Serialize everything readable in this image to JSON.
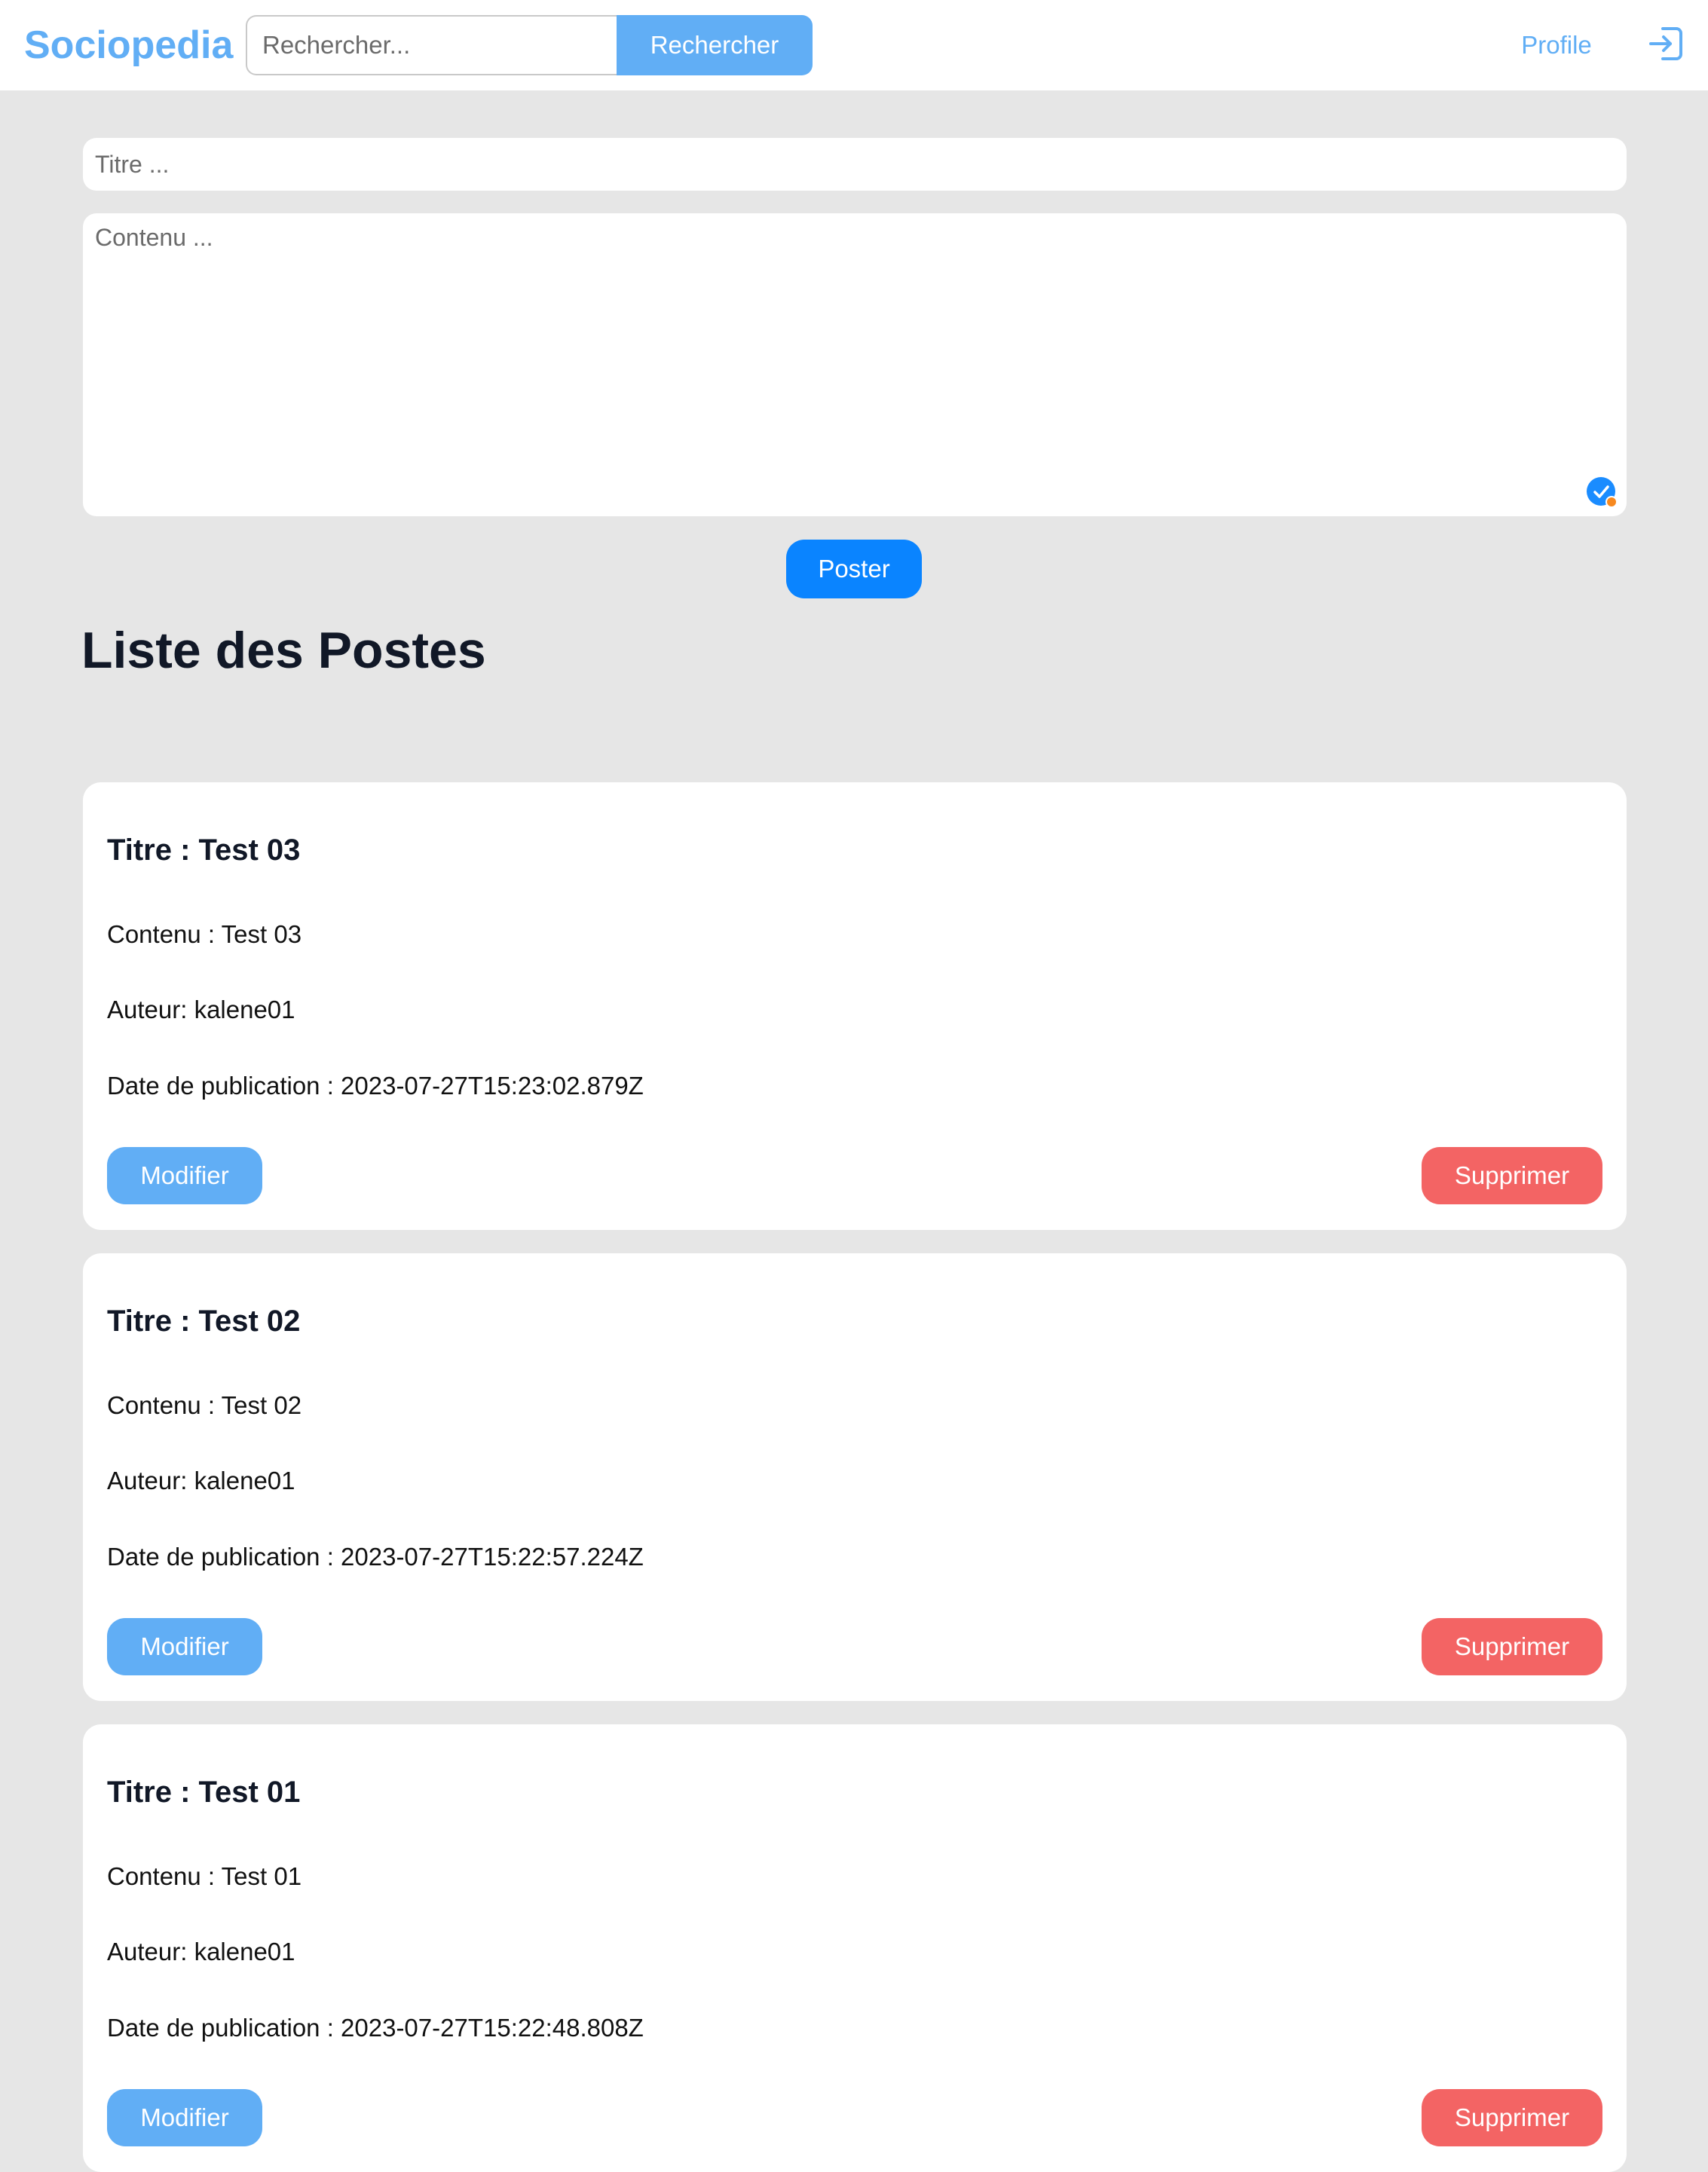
{
  "header": {
    "brand": "Sociopedia",
    "search_placeholder": "Rechercher...",
    "search_button": "Rechercher",
    "profile_link": "Profile",
    "logout_icon": "logout-icon"
  },
  "composer": {
    "title_placeholder": "Titre ...",
    "content_placeholder": "Contenu ...",
    "post_button": "Poster",
    "badge_icon": "grammar-check-icon"
  },
  "section_title": "Liste des Postes",
  "posts": [
    {
      "title": "Titre : Test 03",
      "content": "Contenu : Test 03",
      "author": "Auteur: kalene01",
      "date": "Date de publication : 2023-07-27T15:23:02.879Z",
      "edit_label": "Modifier",
      "delete_label": "Supprimer"
    },
    {
      "title": "Titre : Test 02",
      "content": "Contenu : Test 02",
      "author": "Auteur: kalene01",
      "date": "Date de publication : 2023-07-27T15:22:57.224Z",
      "edit_label": "Modifier",
      "delete_label": "Supprimer"
    },
    {
      "title": "Titre : Test 01",
      "content": "Contenu : Test 01",
      "author": "Auteur: kalene01",
      "date": "Date de publication : 2023-07-27T15:22:48.808Z",
      "edit_label": "Modifier",
      "delete_label": "Supprimer"
    }
  ],
  "colors": {
    "brand_blue": "#61aef5",
    "primary_blue": "#0a84ff",
    "danger_red": "#f36464",
    "background": "#e6e6e6"
  }
}
